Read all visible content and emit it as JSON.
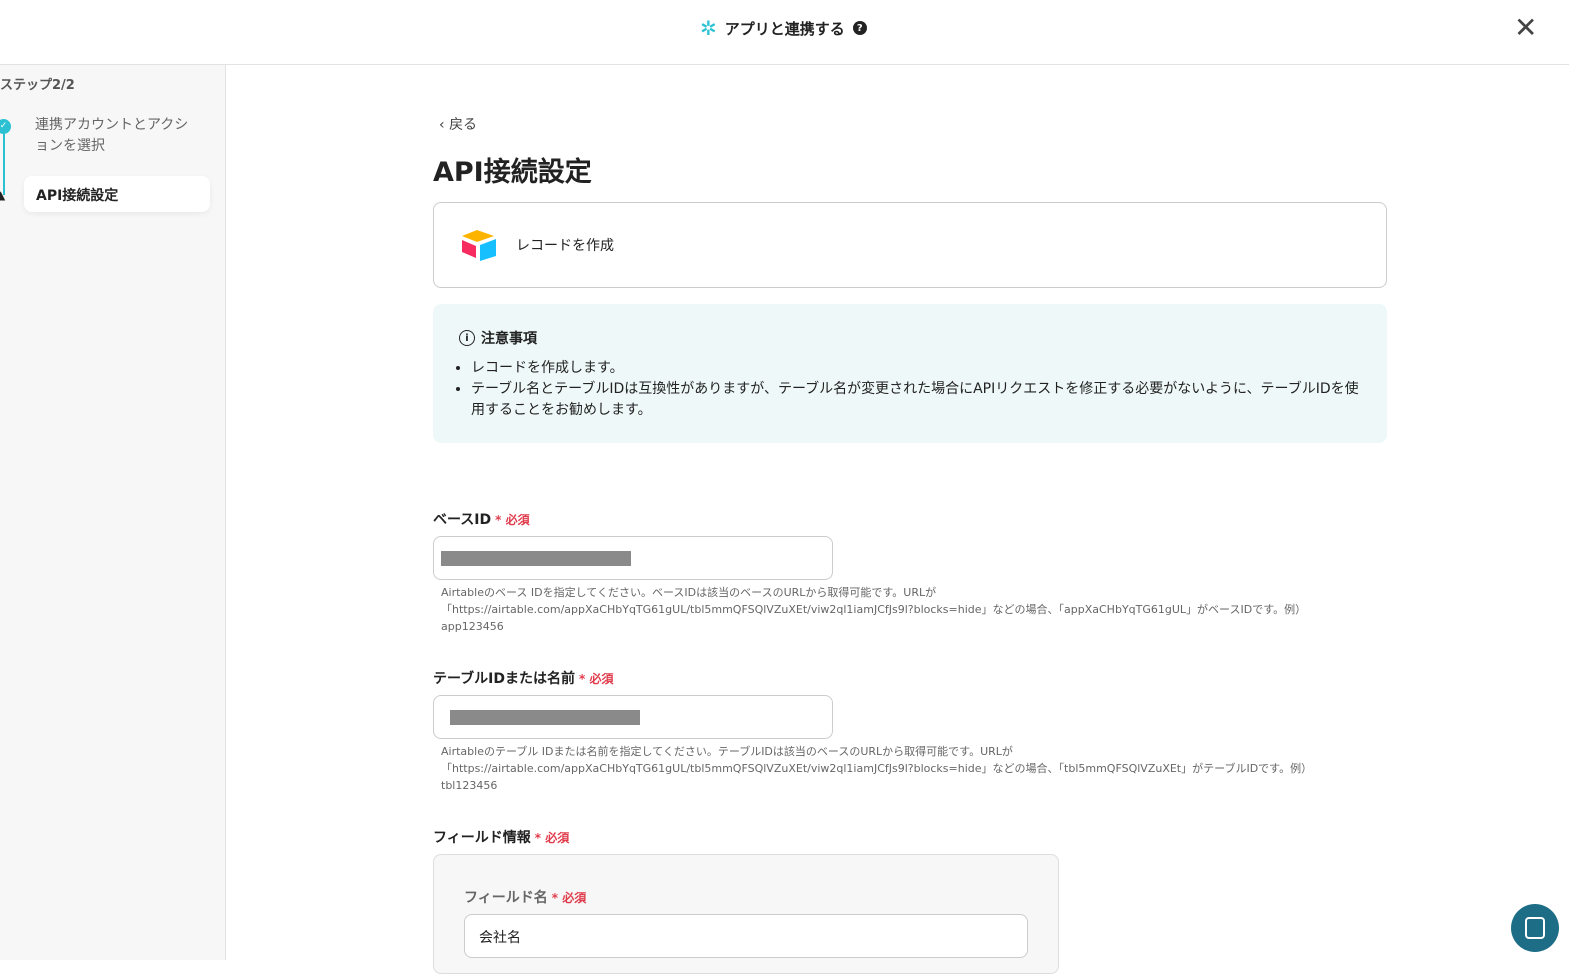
{
  "header": {
    "title": "アプリと連携する",
    "help_icon": "?",
    "close_icon": "✕"
  },
  "sidebar": {
    "step_label": "ステップ2/2",
    "steps": [
      {
        "label": "連携アカウントとアクションを選択",
        "status": "done"
      },
      {
        "label": "API接続設定",
        "status": "warning"
      }
    ]
  },
  "main": {
    "back": "戻る",
    "title": "API接続設定",
    "action": "レコードを作成",
    "notice": {
      "title": "注意事項",
      "items": [
        "レコードを作成します。",
        "テーブル名とテーブルIDは互換性がありますが、テーブル名が変更された場合にAPIリクエストを修正する必要がないように、テーブルIDを使用することをお勧めします。"
      ]
    },
    "required": "必須",
    "fields": [
      {
        "label": "ベースID",
        "hint": "Airtableのベース IDを指定してください。ベースIDは該当のベースのURLから取得可能です。URLが「https://airtable.com/appXaCHbYqTG61gUL/tbl5mmQFSQlVZuXEt/viw2ql1iamJCfJs9l?blocks=hide」などの場合、「appXaCHbYqTG61gUL」がベースIDです。例）app123456"
      },
      {
        "label": "テーブルIDまたは名前",
        "hint": "Airtableのテーブル IDまたは名前を指定してください。テーブルIDは該当のベースのURLから取得可能です。URLが「https://airtable.com/appXaCHbYqTG61gUL/tbl5mmQFSQlVZuXEt/viw2ql1iamJCfJs9l?blocks=hide」などの場合、「tbl5mmQFSQlVZuXEt」がテーブルIDです。例）tbl123456"
      },
      {
        "label": "フィールド情報"
      }
    ],
    "field_name_label": "フィールド名",
    "field_name_value": "会社名"
  }
}
